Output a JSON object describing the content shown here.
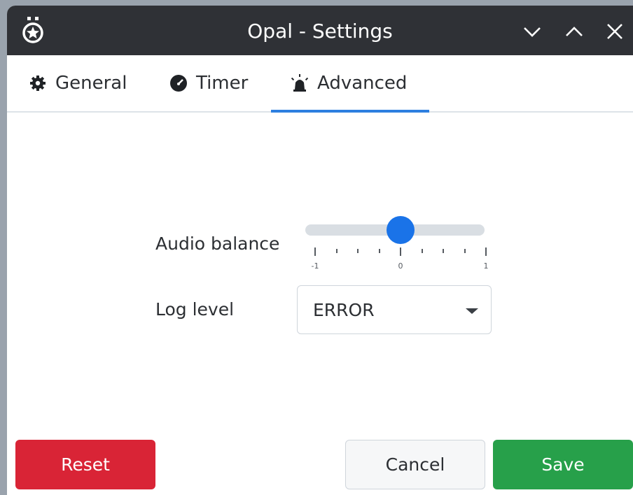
{
  "window": {
    "title": "Opal - Settings"
  },
  "tabs": [
    {
      "label": "General",
      "icon": "gear-icon"
    },
    {
      "label": "Timer",
      "icon": "gauge-icon"
    },
    {
      "label": "Advanced",
      "icon": "alarm-icon",
      "selected": true
    }
  ],
  "audio_balance": {
    "label": "Audio balance",
    "value": 0,
    "min": -1,
    "max": 1,
    "tick_labels": [
      "-1",
      "0",
      "1"
    ]
  },
  "log_level": {
    "label": "Log level",
    "value": "ERROR"
  },
  "buttons": {
    "reset": "Reset",
    "cancel": "Cancel",
    "save": "Save"
  },
  "colors": {
    "accent": "#1a73e8",
    "reset": "#d92436",
    "save": "#27a04a",
    "titlebar": "#2f3136"
  }
}
